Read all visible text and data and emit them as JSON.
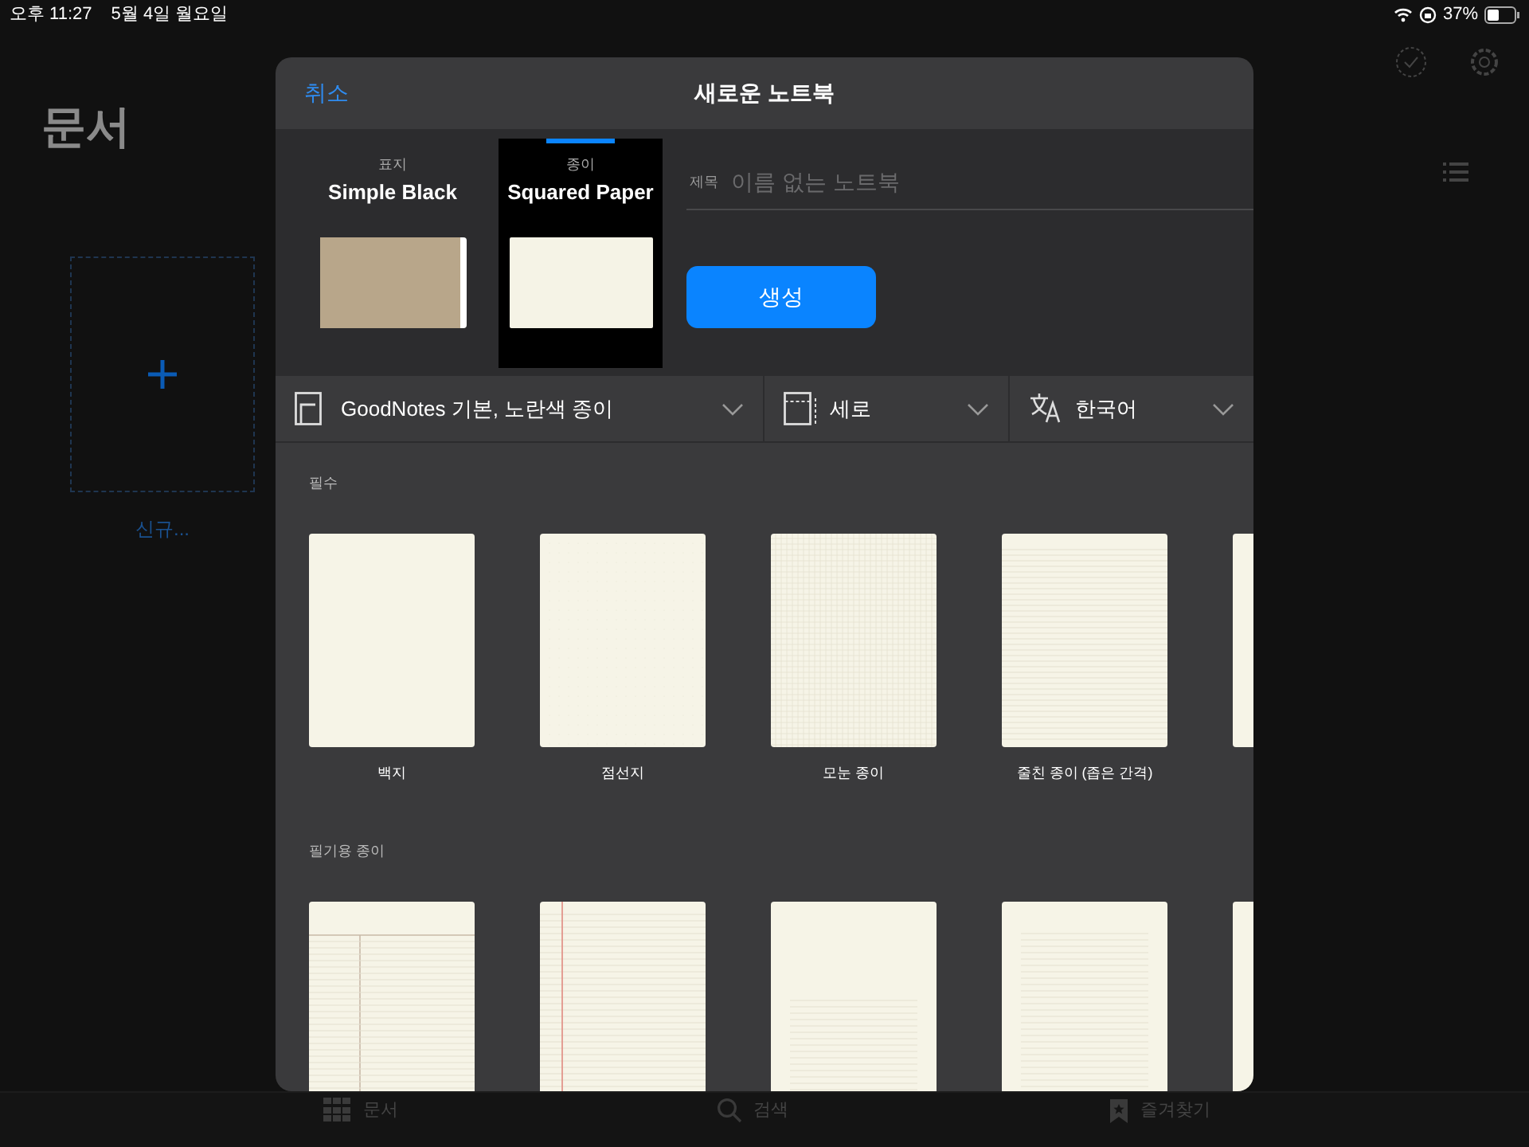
{
  "status_bar": {
    "time": "오후 11:27",
    "date": "5월 4일 월요일",
    "battery": "37%"
  },
  "library": {
    "title": "문서",
    "new_label": "신규..."
  },
  "tab_bar": [
    {
      "kind": "documents",
      "label": "문서"
    },
    {
      "kind": "search",
      "label": "검색"
    },
    {
      "kind": "favorites",
      "label": "즐겨찾기"
    }
  ],
  "dialog": {
    "cancel": "취소",
    "title": "새로운 노트북",
    "choices": [
      {
        "kind": "cover",
        "caption": "표지",
        "name": "Simple Black",
        "selected": false
      },
      {
        "kind": "paper",
        "caption": "종이",
        "name": "Squared Paper",
        "selected": true
      }
    ],
    "title_field": {
      "label": "제목",
      "placeholder": "이름 없는 노트북"
    },
    "create_button": "생성",
    "filters": [
      {
        "kind": "template",
        "value": "GoodNotes 기본, 노란색 종이"
      },
      {
        "kind": "orientation",
        "value": "세로"
      },
      {
        "kind": "language",
        "value": "한국어"
      }
    ],
    "sections": [
      {
        "title": "필수",
        "templates": [
          {
            "kind": "blank",
            "label": "백지"
          },
          {
            "kind": "dotted",
            "label": "점선지"
          },
          {
            "kind": "grid",
            "label": "모눈 종이"
          },
          {
            "kind": "ruled",
            "label": "줄친 종이 (좁은 간격)"
          },
          {
            "kind": "blank"
          }
        ]
      },
      {
        "title": "필기용 종이",
        "templates": [
          {
            "kind": "cornell"
          },
          {
            "kind": "legal"
          },
          {
            "kind": "ruled_wide"
          },
          {
            "kind": "ruled_margin"
          },
          {
            "kind": "blank"
          }
        ]
      }
    ]
  }
}
